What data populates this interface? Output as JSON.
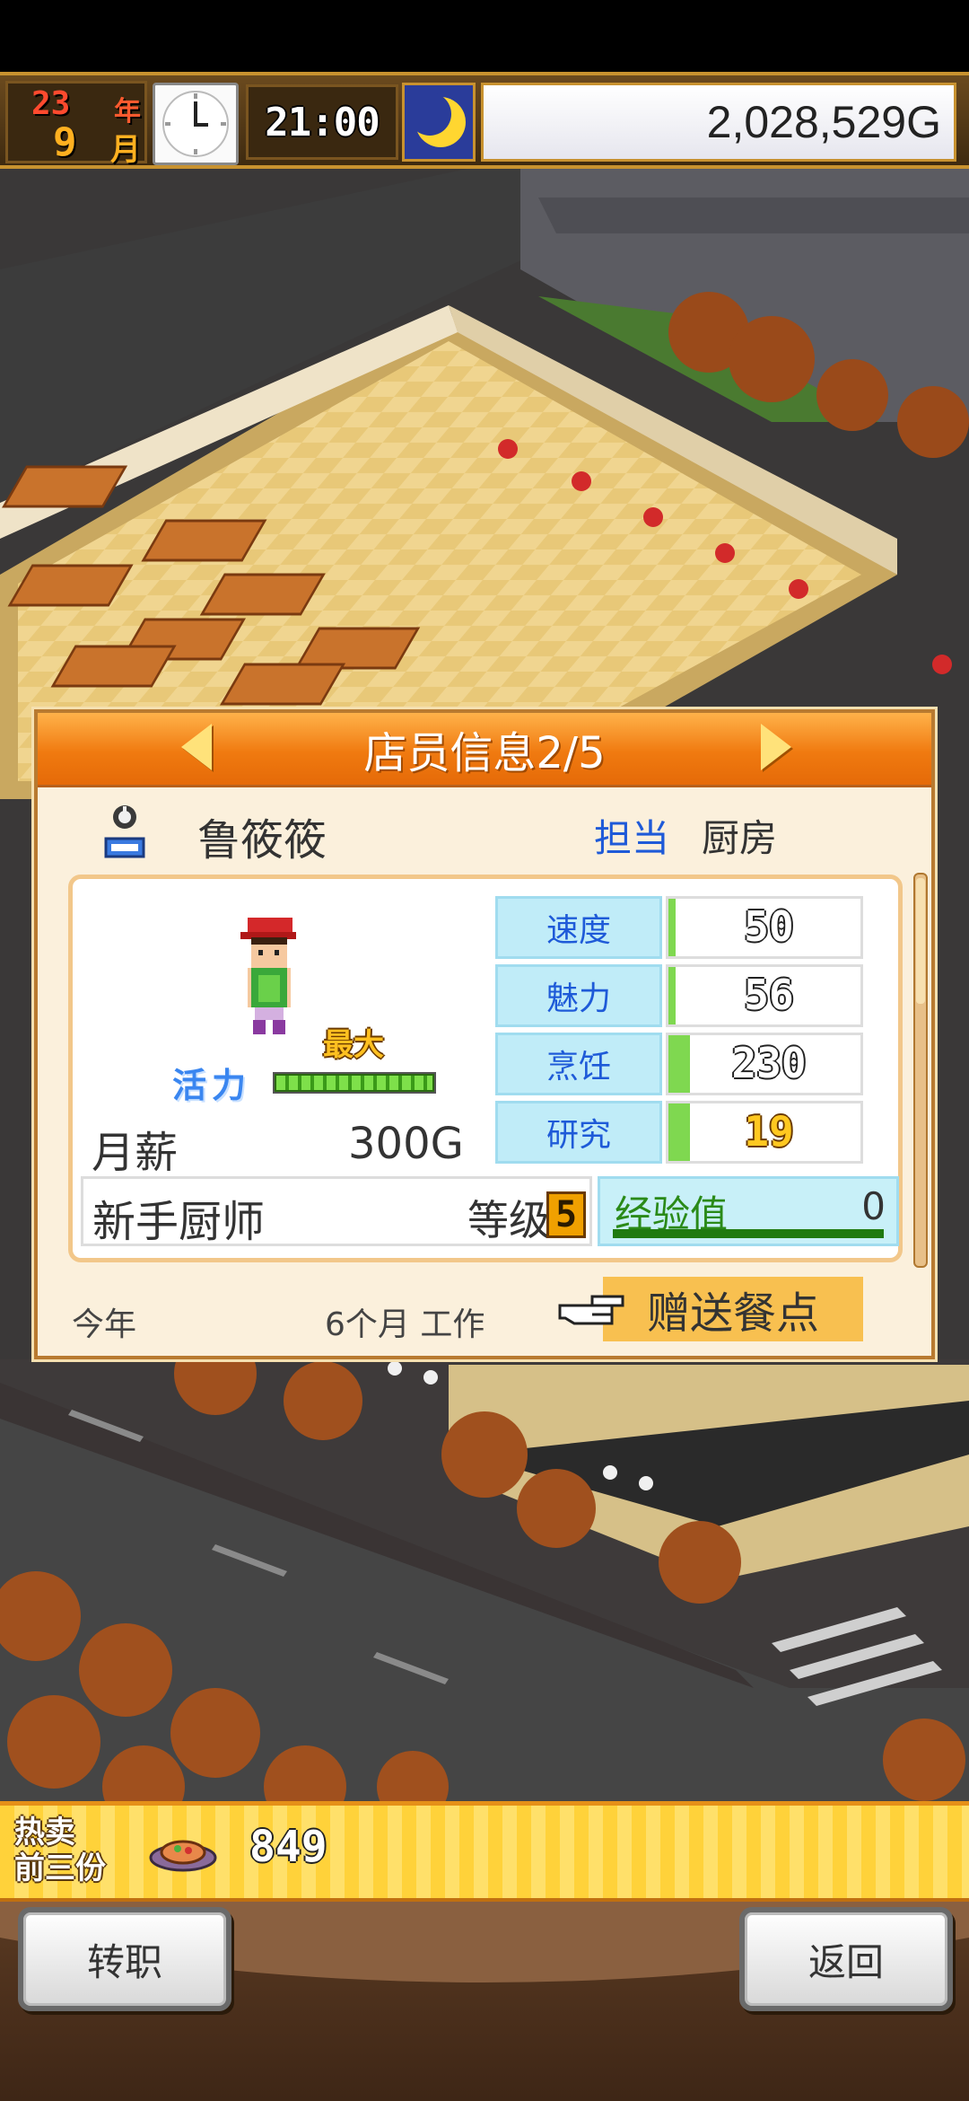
{
  "hud": {
    "year": "23",
    "year_unit": "年",
    "month": "9",
    "month_unit": "月",
    "time": "21:00",
    "money": "2,028,529G"
  },
  "panel": {
    "title": "店员信息2/5",
    "employee_name": "鲁筱筱",
    "assign_label": "担当",
    "assign_value": "厨房",
    "max_label": "最大",
    "vitality_label": "活力",
    "vitality_level": 1.0,
    "salary_label": "月薪",
    "salary_value": "300G",
    "stats": [
      {
        "label": "速度",
        "value": "50",
        "fill": 0.02
      },
      {
        "label": "魅力",
        "value": "56",
        "fill": 0.02
      },
      {
        "label": "烹饪",
        "value": "230",
        "fill": 0.11
      },
      {
        "label": "研究",
        "value": "19",
        "fill": 0.11
      }
    ],
    "job_title": "新手厨师",
    "level_label": "等级",
    "level": "5",
    "exp_label": "经验值",
    "exp_value": "0",
    "year_label": "今年",
    "work_label": "6个月 工作",
    "gift_button": "赠送餐点"
  },
  "best_seller": {
    "label_line1": "热卖",
    "label_line2": "前三份",
    "value": "849"
  },
  "buttons": {
    "change_job": "转职",
    "back": "返回"
  },
  "colors": {
    "header_orange": "#f07a10",
    "stat_label_bg": "#c0ecf8",
    "stat_fill": "#7fd850",
    "gift_button_bg": "#f8c050",
    "assign_blue": "#1e5ad8"
  },
  "icons": [
    "clock-icon",
    "moon-icon",
    "arrow-left-icon",
    "arrow-right-icon",
    "kitchen-staff-icon",
    "hand-pointer-icon",
    "food-dish-icon"
  ]
}
